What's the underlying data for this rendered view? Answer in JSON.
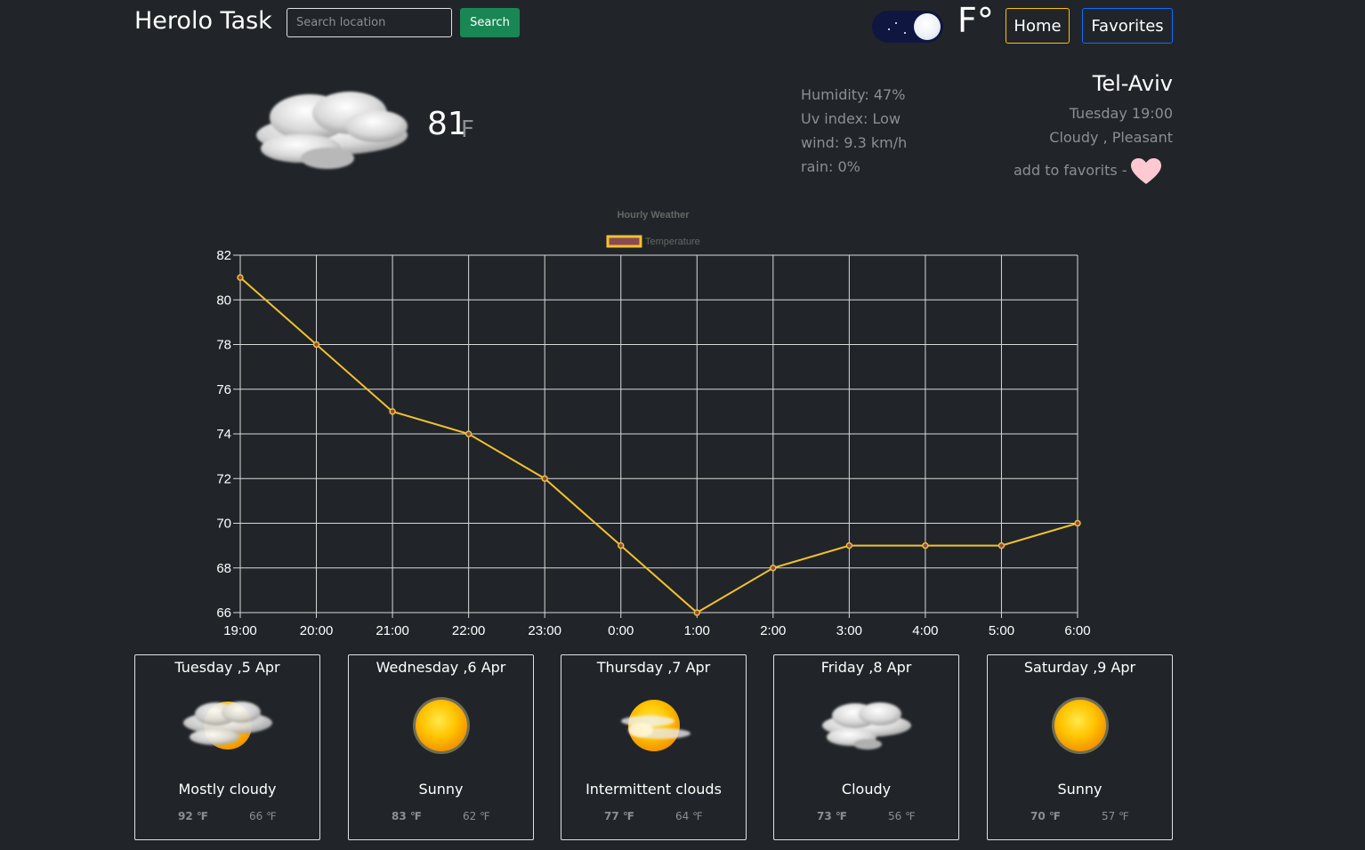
{
  "header": {
    "brand": "Herolo Task",
    "search_placeholder": "Search location",
    "search_label": "Search",
    "unit_label": "F°",
    "nav_home": "Home",
    "nav_favorites": "Favorites"
  },
  "current": {
    "icon": "cloud-icon",
    "temp": "81",
    "unit": "F",
    "details": [
      "Humidity: 47%",
      "Uv index: Low",
      "wind: 9.3 km/h",
      "rain: 0%"
    ],
    "city": "Tel-Aviv",
    "day_time": "Tuesday 19:00",
    "condition": "Cloudy , Pleasant",
    "add_favorite_label": "add to favorits -"
  },
  "chart_data": {
    "type": "line",
    "title": "Hourly Weather",
    "categories": [
      "19:00",
      "20:00",
      "21:00",
      "22:00",
      "23:00",
      "0:00",
      "1:00",
      "2:00",
      "3:00",
      "4:00",
      "5:00",
      "6:00"
    ],
    "series": [
      {
        "name": "Temperature",
        "values": [
          81,
          78,
          75,
          74,
          72,
          69,
          66,
          68,
          69,
          69,
          69,
          70
        ]
      }
    ],
    "ylim": [
      66,
      82
    ],
    "yticks": [
      66,
      68,
      70,
      72,
      74,
      76,
      78,
      80,
      82
    ],
    "grid": true,
    "legend": "top",
    "colors": {
      "line": "#f2c12e",
      "legend_fill": "#8b4a52",
      "grid": "#d9d9d9"
    }
  },
  "forecast": [
    {
      "date": "Tuesday ,5 Apr",
      "icon": "mostly-cloudy-icon",
      "desc": "Mostly cloudy",
      "max": "92 ℉",
      "min": "66 ℉"
    },
    {
      "date": "Wednesday ,6 Apr",
      "icon": "sun-icon",
      "desc": "Sunny",
      "max": "83 ℉",
      "min": "62 ℉"
    },
    {
      "date": "Thursday ,7 Apr",
      "icon": "intermittent-clouds-icon",
      "desc": "Intermittent clouds",
      "max": "77 ℉",
      "min": "64 ℉"
    },
    {
      "date": "Friday ,8 Apr",
      "icon": "cloud-icon",
      "desc": "Cloudy",
      "max": "73 ℉",
      "min": "56 ℉"
    },
    {
      "date": "Saturday ,9 Apr",
      "icon": "sun-icon",
      "desc": "Sunny",
      "max": "70 ℉",
      "min": "57 ℉"
    }
  ]
}
